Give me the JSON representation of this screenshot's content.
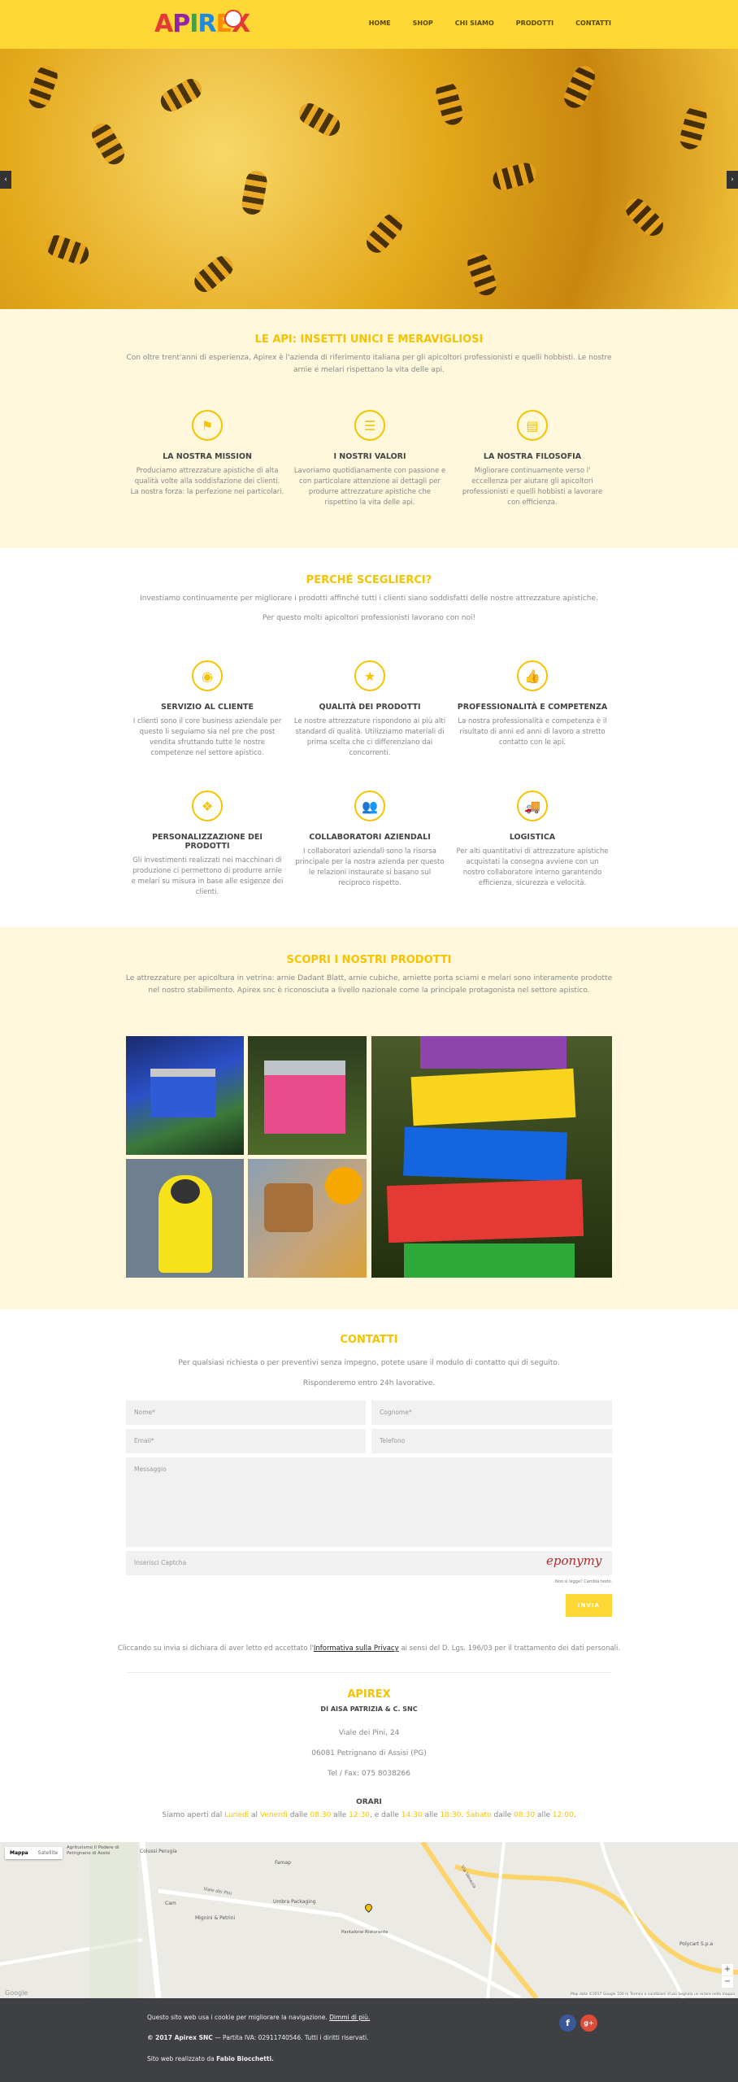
{
  "header": {
    "logo_text": "APIREX",
    "nav": [
      "HOME",
      "SHOP",
      "CHI SIAMO",
      "PRODOTTI",
      "CONTATTI"
    ]
  },
  "hero": {
    "prev": "‹",
    "next": "›"
  },
  "intro": {
    "title": "LE API: INSETTI UNICI E MERAVIGLIOSI",
    "text": "Con oltre trent'anni di esperienza, Apirex è l'azienda di riferimento italiana per gli apicoltori professionisti e quelli hobbisti. Le nostre arnie e melari rispettano la vita delle api.",
    "cols": [
      {
        "icon": "flag-icon",
        "glyph": "⚑",
        "title": "LA NOSTRA MISSION",
        "text": "Produciamo attrezzature apistiche di alta qualità volte alla soddisfazione dei clienti. La nostra forza: la perfezione nei particolari."
      },
      {
        "icon": "list-icon",
        "glyph": "☰",
        "title": "I NOSTRI VALORI",
        "text": "Lavoriamo quotidianamente con passione e con particolare attenzione ai dettagli per produrre attrezzature apistiche che rispettino la vita delle api."
      },
      {
        "icon": "document-icon",
        "glyph": "▤",
        "title": "LA NOSTRA FILOSOFIA",
        "text": "Migliorare continuamente verso l' eccellenza per aiutare gli apicoltori professionisti e quelli hobbisti a lavorare con efficienza."
      }
    ]
  },
  "why": {
    "title": "PERCHÉ SCEGLIERCI?",
    "text1": "Investiamo continuamente per migliorare i prodotti affinché tutti i clienti siano soddisfatti delle nostre attrezzature apistiche.",
    "text2": "Per questo molti apicoltori professionisti lavorano con noi!",
    "row1": [
      {
        "icon": "eye-icon",
        "glyph": "◉",
        "title": "SERVIZIO AL CLIENTE",
        "text": "I clienti sono il core business aziendale per questo li seguiamo sia nel pre che post vendita sfruttando tutte le nostre competenze nel settore apistico."
      },
      {
        "icon": "star-icon",
        "glyph": "★",
        "title": "QUALITÀ DEI PRODOTTI",
        "text": "Le nostre attrezzature rispondono ai più alti standard di qualità. Utilizziamo materiali di prima scelta che ci differenziano dai concorrenti."
      },
      {
        "icon": "thumbs-up-icon",
        "glyph": "👍",
        "title": "PROFESSIONALITÀ E COMPETENZA",
        "text": "La nostra professionalità e competenza è il risultato di anni ed anni di lavoro a stretto contatto con le api."
      }
    ],
    "row2": [
      {
        "icon": "cubes-icon",
        "glyph": "❖",
        "title": "PERSONALIZZAZIONE DEI PRODOTTI",
        "text": "Gli investimenti realizzati nei macchinari di produzione ci permettono di produrre arnie e melari su misura in base alle esigenze dei clienti."
      },
      {
        "icon": "users-icon",
        "glyph": "👥",
        "title": "COLLABORATORI AZIENDALI",
        "text": "I collaboratori aziendali sono la risorsa principale per la nostra azienda per questo le relazioni instaurate si basano sul reciproco rispetto."
      },
      {
        "icon": "truck-icon",
        "glyph": "🚚",
        "title": "LOGISTICA",
        "text": "Per alti quantitativi di attrezzature apistiche acquistati la consegna avviene con un nostro collaboratore interno garantendo efficienza, sicurezza e velocità."
      }
    ]
  },
  "products": {
    "title": "SCOPRI I NOSTRI PRODOTTI",
    "text": "Le attrezzature per apicoltura in vetrina: arnie Dadant Blatt, arnie cubiche, arniette porta sciami e melari sono interamente prodotte nel nostro stabilimento. Apirex snc è riconosciuta a livello nazionale come la principale protagonista nel settore apistico."
  },
  "contact": {
    "title": "CONTATTI",
    "text1": "Per qualsiasi richiesta o per preventivi senza impegno, potete usare il modulo di contatto qui di seguito.",
    "text2": "Risponderemo entro 24h lavorative.",
    "name_ph": "Nome*",
    "surname_ph": "Cognome*",
    "email_ph": "Email*",
    "phone_ph": "Telefono",
    "message_ph": "Messaggio",
    "captcha_ph": "Inserisci Captcha",
    "captcha_img": "eponymy",
    "captcha_sub": "Non si legge? Cambia testo.",
    "submit": "INVIA",
    "privacy_pre": "Cliccando su invia si dichiara di aver letto ed accettato l'",
    "privacy_link": "Informativa sulla Privacy",
    "privacy_post": " ai sensi del D. Lgs. 196/03 per il trattamento dei dati personali."
  },
  "company": {
    "name": "APIREX",
    "sub": "DI AISA PATRIZIA & C. SNC",
    "street": "Viale dei Pini, 24",
    "city": "06081 Petrignano di Assisi (PG)",
    "tel": "Tel / Fax: 075 8038266",
    "hours_title": "ORARI",
    "h1": "Siamo aperti dal ",
    "d1": "Lunedì",
    "h2": " al ",
    "d2": "Venerdì",
    "h3": " dalle ",
    "t1": "08:30",
    "h4": " alle ",
    "t2": "12:30",
    "h5": ", e dalle ",
    "t3": "14:30",
    "h6": " alle ",
    "t4": "18:30",
    "h7": ". ",
    "d3": "Sabato",
    "h8": " dalle ",
    "t5": "08:30",
    "h9": " alle ",
    "t6": "12:00",
    "h10": "."
  },
  "map": {
    "tab_map": "Mappa",
    "tab_sat": "Satellite",
    "labels": [
      "Agriturismo Il Podere di Petrignano di Assisi",
      "Colussi Perugia",
      "Famap",
      "Cam",
      "Umbra Packaging",
      "Mignini & Petrini",
      "Pantalone Ristorante",
      "Viale dei Pini",
      "Polycart S.p.a",
      "Via Venezia"
    ],
    "zoom_in": "+",
    "zoom_out": "−",
    "attribution": "Map data ©2017 Google   100 m   Termini e condizioni d'uso   Segnala un errore nella mappa",
    "google": "Google"
  },
  "footer": {
    "cookie": "Questo sito web usa i cookie per migliorare la navigazione. ",
    "cookie_link": "Dimmi di più.",
    "copyright_bold": "© 2017 Apirex SNC",
    "copyright_rest": " — Partita IVA: 02911740546. Tutti i diritti riservati.",
    "credits_pre": "Sito web realizzato da ",
    "credits_name": "Fabio Biocchetti.",
    "facebook": "f",
    "google_plus": "g+"
  }
}
